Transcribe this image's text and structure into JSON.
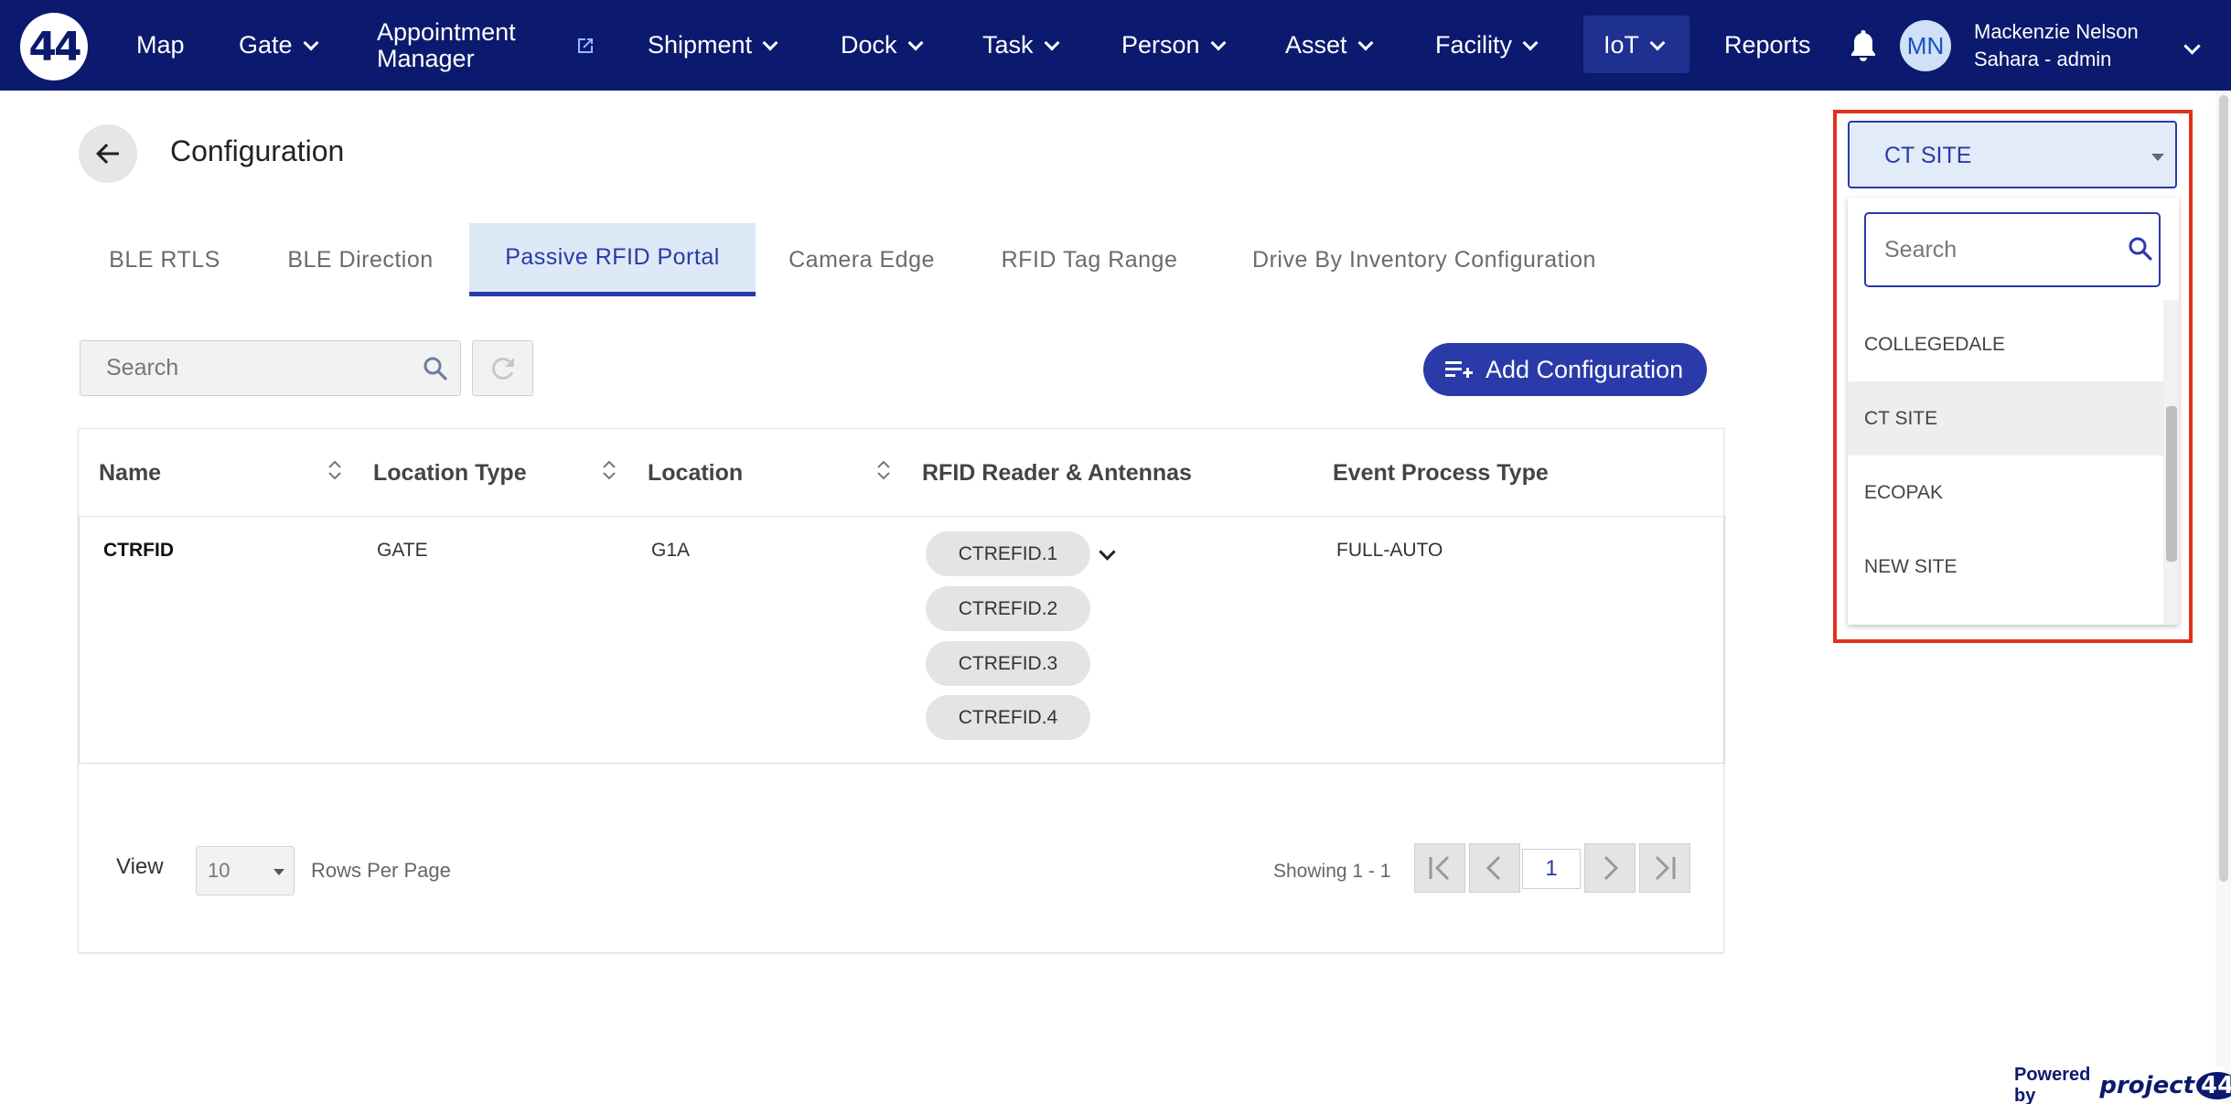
{
  "nav": {
    "logo_text": "44",
    "items": {
      "map": "Map",
      "gate": "Gate",
      "appointment_line1": "Appointment",
      "appointment_line2": "Manager",
      "shipment": "Shipment",
      "dock": "Dock",
      "task": "Task",
      "person": "Person",
      "asset": "Asset",
      "facility": "Facility",
      "iot": "IoT",
      "reports": "Reports"
    },
    "avatar_initials": "MN",
    "user_name": "Mackenzie Nelson",
    "user_role": "Sahara - admin",
    "accent_color": "#0b1a6e"
  },
  "header": {
    "title": "Configuration"
  },
  "tabs": [
    {
      "label": "BLE RTLS"
    },
    {
      "label": "BLE Direction"
    },
    {
      "label": "Passive RFID Portal"
    },
    {
      "label": "Camera Edge"
    },
    {
      "label": "RFID Tag Range"
    },
    {
      "label": "Drive By Inventory Configuration"
    }
  ],
  "toolbar": {
    "search_placeholder": "Search",
    "add_label": "Add Configuration"
  },
  "table": {
    "columns": [
      "Name",
      "Location Type",
      "Location",
      "RFID Reader & Antennas",
      "Event Process Type"
    ],
    "rows": [
      {
        "name": "CTRFID",
        "location_type": "GATE",
        "location": "G1A",
        "antennas": [
          "CTREFID.1",
          "CTREFID.2",
          "CTREFID.3",
          "CTREFID.4"
        ],
        "event_process_type": "FULL-AUTO"
      }
    ]
  },
  "footer": {
    "view_label": "View",
    "rows_per_page_value": "10",
    "rows_per_page_label": "Rows Per Page",
    "showing": "Showing 1 - 1",
    "current_page": "1"
  },
  "site_dropdown": {
    "selected": "CT SITE",
    "search_placeholder": "Search",
    "options": [
      "COLLEGEDALE",
      "CT SITE",
      "ECOPAK",
      "NEW SITE"
    ],
    "highlight_color": "#e0311f"
  },
  "badge": {
    "powered_by": "Powered by",
    "brand_text": "project",
    "brand_number": "44"
  }
}
